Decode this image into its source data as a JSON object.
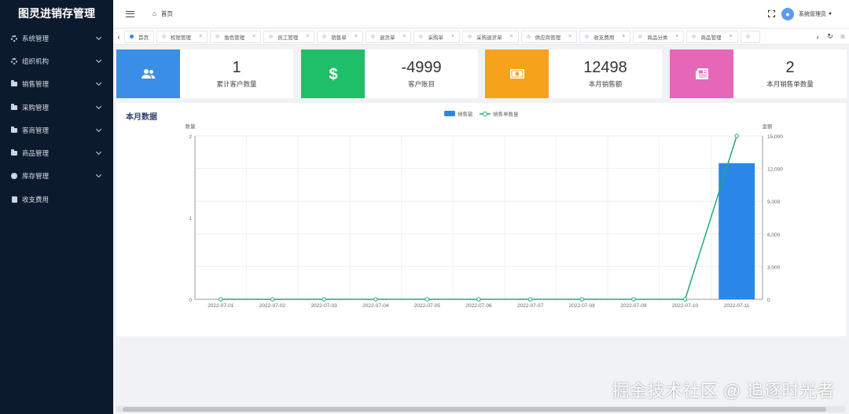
{
  "app": {
    "title": "图灵进销存管理"
  },
  "sidebar": {
    "items": [
      {
        "label": "系统管理",
        "icon": "gear-icon",
        "expandable": true
      },
      {
        "label": "组织机构",
        "icon": "gear-icon",
        "expandable": true
      },
      {
        "label": "销售管理",
        "icon": "folder-icon",
        "expandable": true
      },
      {
        "label": "采购管理",
        "icon": "folder-icon",
        "expandable": true
      },
      {
        "label": "客商管理",
        "icon": "folder-icon",
        "expandable": true
      },
      {
        "label": "商品管理",
        "icon": "folder-icon",
        "expandable": true
      },
      {
        "label": "库存管理",
        "icon": "disc-icon",
        "expandable": true
      },
      {
        "label": "收支费用",
        "icon": "document-icon",
        "expandable": false
      }
    ]
  },
  "header": {
    "breadcrumb": "首页",
    "user_name": "系统管理员"
  },
  "tabs": [
    {
      "label": "首页",
      "active": true,
      "closable": false
    },
    {
      "label": "权限管理",
      "active": false,
      "closable": true
    },
    {
      "label": "角色管理",
      "active": false,
      "closable": true
    },
    {
      "label": "员工管理",
      "active": false,
      "closable": true
    },
    {
      "label": "销售单",
      "active": false,
      "closable": true
    },
    {
      "label": "退货单",
      "active": false,
      "closable": true
    },
    {
      "label": "采购单",
      "active": false,
      "closable": true
    },
    {
      "label": "采购退货单",
      "active": false,
      "closable": true
    },
    {
      "label": "供应商管理",
      "active": false,
      "closable": true
    },
    {
      "label": "收支费用",
      "active": false,
      "closable": true
    },
    {
      "label": "商品分类",
      "active": false,
      "closable": true
    },
    {
      "label": "商品管理",
      "active": false,
      "closable": true
    },
    {
      "label": "",
      "active": false,
      "closable": false
    }
  ],
  "stats": {
    "customers": {
      "value": "1",
      "label": "累计客户数量",
      "color": "#3a8ee6",
      "icon": "users-icon"
    },
    "accounts": {
      "value": "-4999",
      "label": "客户账目",
      "color": "#1fbf6a",
      "icon": "dollar-icon"
    },
    "sales_amount": {
      "value": "12498",
      "label": "本月销售额",
      "color": "#f7a21b",
      "icon": "money-icon"
    },
    "sales_count": {
      "value": "2",
      "label": "本月销售单数量",
      "color": "#e667b8",
      "icon": "newspaper-icon"
    }
  },
  "panel": {
    "title": "本月数据"
  },
  "chart_data": {
    "type": "bar",
    "categories": [
      "2022-07-01",
      "2022-07-02",
      "2022-07-03",
      "2022-07-04",
      "2022-07-05",
      "2022-07-06",
      "2022-07-07",
      "2022-07-08",
      "2022-07-09",
      "2022-07-10",
      "2022-07-11"
    ],
    "series": [
      {
        "name": "销售额",
        "type": "bar",
        "axis": "right",
        "color": "#2b88e8",
        "values": [
          0,
          0,
          0,
          0,
          0,
          0,
          0,
          0,
          0,
          0,
          12498
        ]
      },
      {
        "name": "销售单数量",
        "type": "line",
        "axis": "left",
        "color": "#20a87a",
        "values": [
          0,
          0,
          0,
          0,
          0,
          0,
          0,
          0,
          0,
          0,
          2
        ]
      }
    ],
    "ylabel_left": "数量",
    "ylabel_right": "金额",
    "yleft_ticks": [
      "0",
      "1",
      "2"
    ],
    "yright_ticks": [
      "0",
      "3,000",
      "6,000",
      "9,000",
      "12,000",
      "15,000"
    ],
    "yleft_range": [
      0,
      2
    ],
    "yright_range": [
      0,
      15000
    ],
    "legend_position": "top-center",
    "grid": true
  },
  "watermark": "掘金技术社区 @ 追逐时光者"
}
